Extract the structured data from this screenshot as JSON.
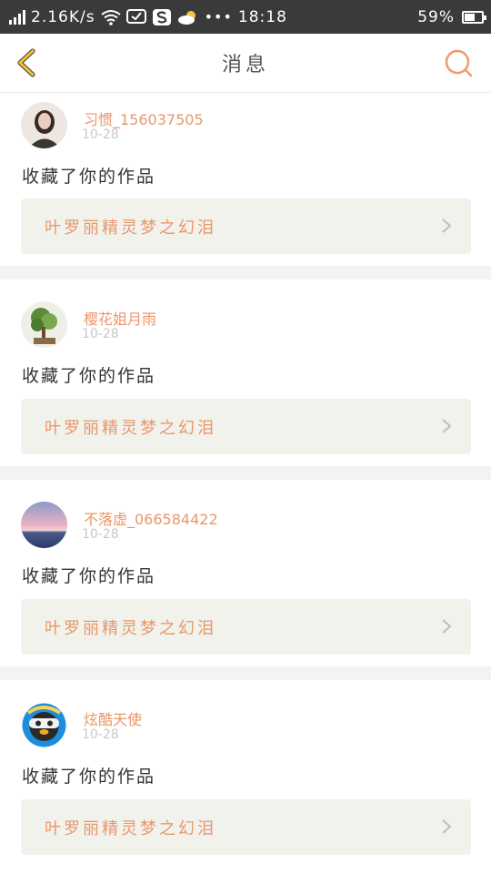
{
  "status_bar": {
    "speed": "2.16K/s",
    "time": "18:18",
    "battery": "59%",
    "battery_level": 0.59
  },
  "header": {
    "title": "消息"
  },
  "messages": [
    {
      "name": "习惯_156037505",
      "date": "10-28",
      "action": "收藏了你的作品",
      "work_title": "叶罗丽精灵梦之幻泪"
    },
    {
      "name": "樱花姐月雨",
      "date": "10-28",
      "action": "收藏了你的作品",
      "work_title": "叶罗丽精灵梦之幻泪"
    },
    {
      "name": "不落虚_066584422",
      "date": "10-28",
      "action": "收藏了你的作品",
      "work_title": "叶罗丽精灵梦之幻泪"
    },
    {
      "name": "炫酷天使",
      "date": "10-28",
      "action": "收藏了你的作品",
      "work_title": "叶罗丽精灵梦之幻泪"
    }
  ]
}
